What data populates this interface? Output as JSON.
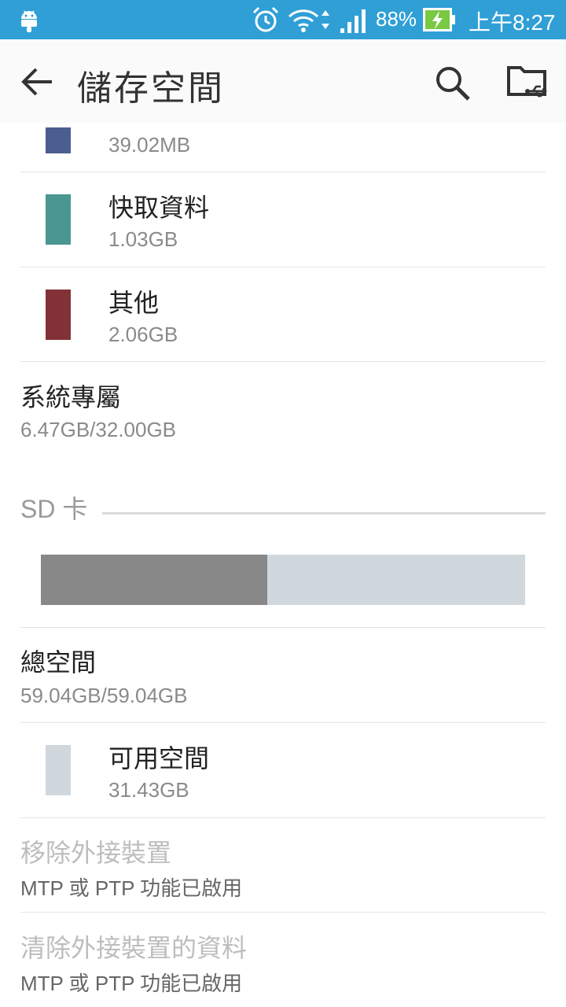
{
  "status_bar": {
    "battery_percent": "88%",
    "time": "上午8:27",
    "icons": [
      "android-icon",
      "alarm-icon",
      "wifi-icon",
      "signal-icon",
      "battery-charging-icon"
    ]
  },
  "app_bar": {
    "title": "儲存空間",
    "back_icon": "arrow-left-icon",
    "search_icon": "search-icon",
    "usb_folder_icon": "folder-usb-icon"
  },
  "internal_items": [
    {
      "title": "",
      "size": "39.02MB",
      "color": "#4a5f8f"
    },
    {
      "title": "快取資料",
      "size": "1.03GB",
      "color": "#4a9690"
    },
    {
      "title": "其他",
      "size": "2.06GB",
      "color": "#823236"
    }
  ],
  "system": {
    "title": "系統專屬",
    "value": "6.47GB/32.00GB"
  },
  "sd_card": {
    "header": "SD 卡",
    "usage": {
      "used_fraction": 0.468,
      "used_color": "#888888",
      "free_color": "#d0d8de"
    },
    "total": {
      "title": "總空間",
      "value": "59.04GB/59.04GB"
    },
    "available": {
      "title": "可用空間",
      "size": "31.43GB",
      "color": "#d0d8de"
    },
    "unmount": {
      "title": "移除外接裝置",
      "subtitle": "MTP 或 PTP 功能已啟用"
    },
    "erase": {
      "title": "清除外接裝置的資料",
      "subtitle": "MTP 或 PTP 功能已啟用"
    }
  }
}
